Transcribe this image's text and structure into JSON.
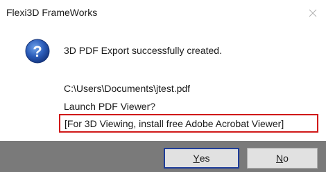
{
  "window": {
    "title": "Flexi3D FrameWorks"
  },
  "icons": {
    "message_icon": "question-icon",
    "close_icon": "close-icon"
  },
  "message": {
    "line1": "3D PDF Export successfully created.",
    "line2": "C:\\Users\\Documents\\jtest.pdf",
    "line3": "Launch PDF Viewer?",
    "line4": "[For 3D Viewing, install free Adobe Acrobat Viewer]"
  },
  "buttons": {
    "yes_mnemonic": "Y",
    "yes_rest": "es",
    "no_mnemonic": "N",
    "no_rest": "o"
  },
  "colors": {
    "highlight_border": "#d01818",
    "default_button_border": "#1f3d99",
    "footer_bg": "#7a7a7a",
    "icon_blue": "#2a5bb8"
  }
}
